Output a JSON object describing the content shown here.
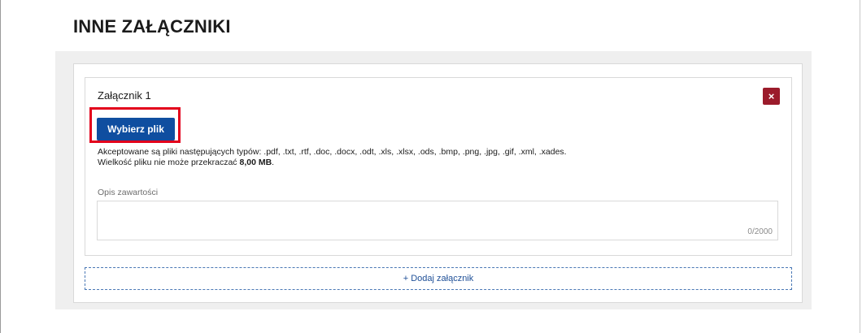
{
  "section": {
    "title": "INNE ZAŁĄCZNIKI"
  },
  "attachment": {
    "title": "Załącznik 1",
    "remove_label": "×",
    "choose_label": "Wybierz plik",
    "info_line1": "Akceptowane są pliki następujących typów: .pdf, .txt, .rtf, .doc, .docx, .odt, .xls, .xlsx, .ods, .bmp, .png, .jpg, .gif, .xml, .xades.",
    "info_line2_prefix": "Wielkość pliku nie może przekraczać ",
    "info_line2_size": "8,00 MB",
    "info_line2_suffix": ".",
    "description_label": "Opis zawartości",
    "description_value": "",
    "counter": "0/2000"
  },
  "add_button_label": "+ Dodaj załącznik",
  "colors": {
    "primary": "#0f4ea0",
    "danger": "#9b1b2b",
    "highlight": "#e3001b"
  }
}
